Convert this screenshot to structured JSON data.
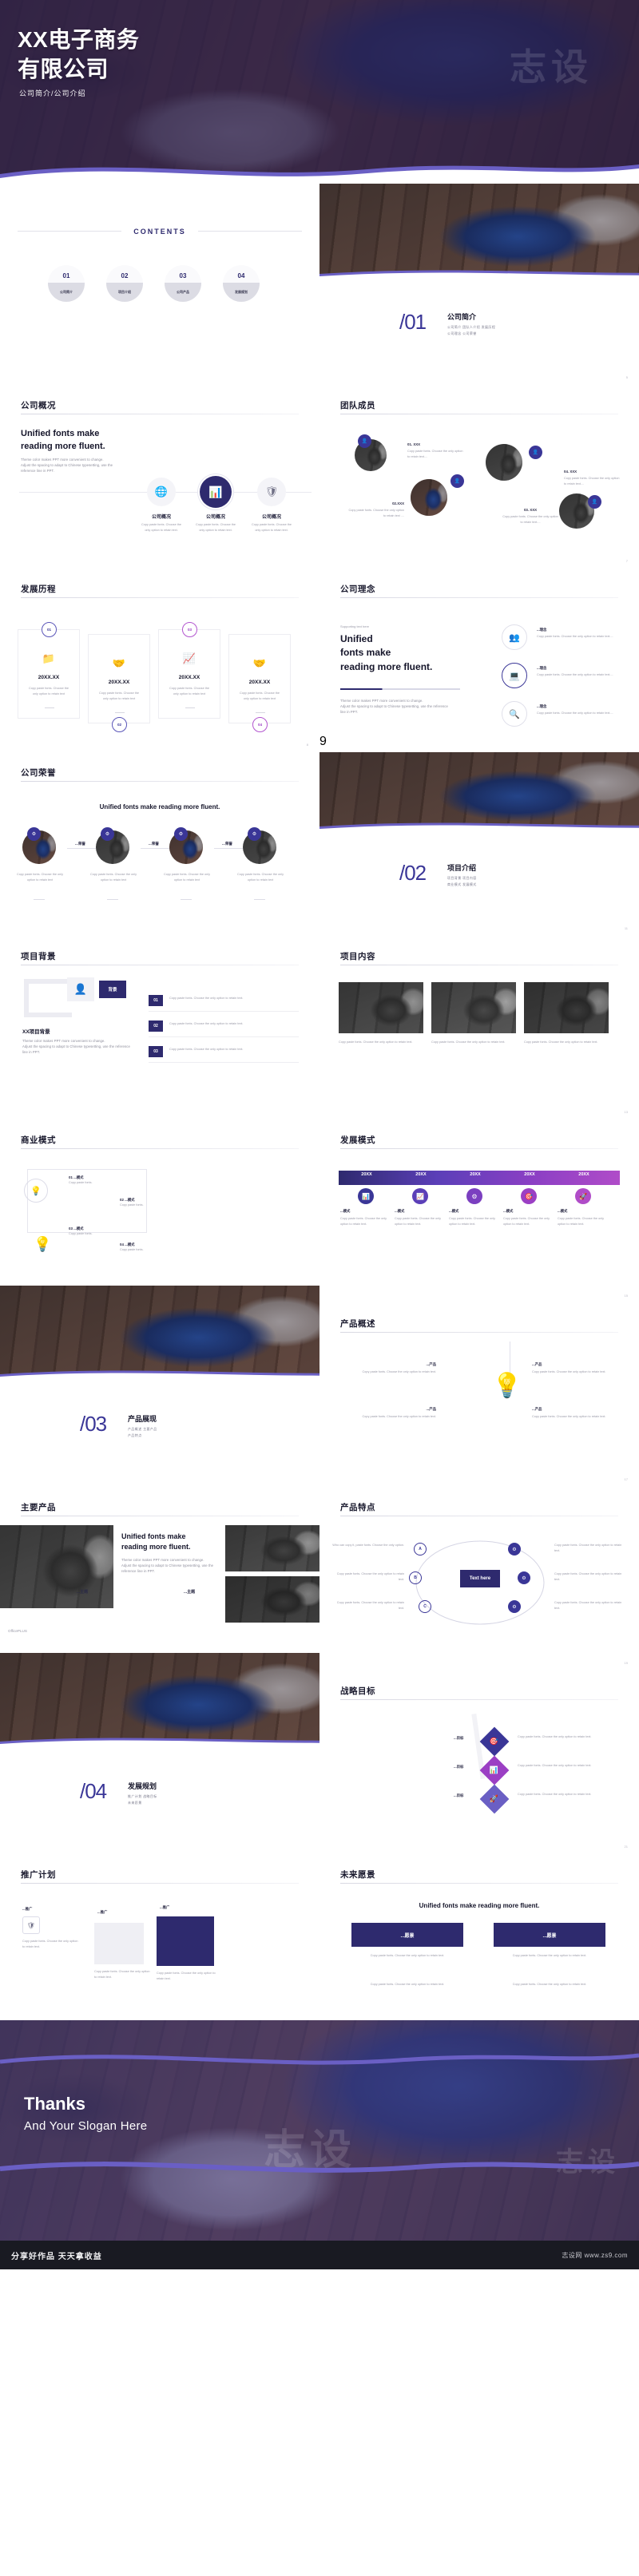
{
  "cover": {
    "title_line1": "XX电子商务",
    "title_line2": "有限公司",
    "subtitle": "公司简介/公司介绍",
    "watermark": "志设"
  },
  "contents": {
    "heading": "CONTENTS",
    "items": [
      {
        "num": "01",
        "label": "公司简介"
      },
      {
        "num": "02",
        "label": "项目介绍"
      },
      {
        "num": "03",
        "label": "公司产品"
      },
      {
        "num": "04",
        "label": "发展规划"
      }
    ]
  },
  "sections": [
    {
      "num": "/01",
      "name": "公司简介",
      "items_l1": "公司简介  团队人介绍  发展历程",
      "items_l2": "公司理念  公司荣誉"
    },
    {
      "num": "/02",
      "name": "项目介绍",
      "items_l1": "项目背景  项目内容",
      "items_l2": "商业模式  发展模式"
    },
    {
      "num": "/03",
      "name": "产品展现",
      "items_l1": "产品概述  主要产品",
      "items_l2": "产品特点"
    },
    {
      "num": "/04",
      "name": "发展规划",
      "items_l1": "推广计划  战略目标",
      "items_l2": "未来愿景"
    }
  ],
  "common": {
    "body_en_1": "Theme color makes PPT more convenient to change.",
    "body_en_2": "Adjust the spacing to adapt to Chinese typesetting, use the",
    "body_en_3": "reference line in PPT.",
    "copy_paste_1": "Copy paste fonts. Choose the",
    "copy_paste_2": "only option to retain text.",
    "copy_paste_long": "Copy paste fonts. Choose the only option to retain text....",
    "heading_2line_a": "Unified fonts make",
    "heading_2line_b": "reading more fluent.",
    "heading_1line": "Unified fonts make reading more fluent.",
    "supporting": "Supporting text here",
    "dash": "——"
  },
  "slide_company_overview": {
    "title": "公司概况",
    "heading_a": "Unified fonts make",
    "heading_b": "reading more fluent.",
    "icons": [
      "globe-icon",
      "chart-bar-icon",
      "shield-icon"
    ],
    "cards": [
      {
        "label": "公司概况",
        "text": "Copy paste fonts. Choose the only option to retain text."
      },
      {
        "label": "公司概况",
        "text": "Copy paste fonts. Choose the only option to retain text."
      },
      {
        "label": "公司概况",
        "text": "Copy paste fonts. Choose the only option to retain text."
      }
    ]
  },
  "slide_team": {
    "title": "团队成员",
    "members": [
      {
        "name": "01. XXX",
        "text": "Copy paste fonts. Choose the only option to retain text...."
      },
      {
        "name": "02.XXX",
        "text": "Copy paste fonts. Choose the only option to retain text ...."
      },
      {
        "name": "03. XXX",
        "text": "Copy paste fonts. Choose the only option to retain text...."
      },
      {
        "name": "04. XXX",
        "text": "Copy paste fonts. Choose the only option to retain text...."
      }
    ]
  },
  "slide_history": {
    "title": "发展历程",
    "steps": [
      {
        "num": "01",
        "date": "20XX.XX",
        "icon": "folder-icon",
        "text_a": "Copy paste fonts. Choose the",
        "text_b": "only option to retain text"
      },
      {
        "num": "02",
        "date": "20XX.XX",
        "icon": "handshake-person-icon",
        "text_a": "Copy paste fonts. Choose the",
        "text_b": "only option to retain text"
      },
      {
        "num": "03",
        "date": "20XX.XX",
        "icon": "growth-chart-icon",
        "text_a": "Copy paste fonts. Choose the",
        "text_b": "only option to retain text"
      },
      {
        "num": "04",
        "date": "20XX.XX",
        "icon": "handshake-icon",
        "text_a": "Copy paste fonts. Choose the",
        "text_b": "only option to retain text"
      }
    ]
  },
  "slide_philosophy": {
    "title": "公司理念",
    "supporting": "Supporting text here",
    "heading_a": "Unified",
    "heading_b": "fonts make",
    "heading_c": "reading more fluent.",
    "body_a": "Theme color makes PPT more convenient to change.",
    "body_b": "Adjust the spacing to adapt to Chinese typesetting, use the reference",
    "body_c": "line in PPT.",
    "items": [
      {
        "label": "...理念",
        "text": "Copy paste fonts. Choose the only option to retain text....",
        "icon": "people-icon"
      },
      {
        "label": "...理念",
        "text": "Copy paste fonts. Choose the only option to retain text....",
        "icon": "desk-icon"
      },
      {
        "label": "...理念",
        "text": "Copy paste fonts. Choose the only option to retain text....",
        "icon": "search-icon"
      }
    ]
  },
  "slide_honors": {
    "title": "公司荣誉",
    "heading": "Unified fonts make reading more fluent.",
    "connector_label": "...荣誉",
    "cards": [
      {
        "text": "Copy paste fonts. Choose the only option to retain text"
      },
      {
        "text": "Copy paste fonts. Choose the only option to retain text"
      },
      {
        "text": "Copy paste fonts. Choose the only option to retain text"
      },
      {
        "text": "Copy paste fonts. Choose the only option to retain text"
      }
    ]
  },
  "slide_bg": {
    "title": "项目背景",
    "badge": "背景",
    "subtitle": "XX项目背景",
    "body_a": "Theme color makes PPT more convenient to change.",
    "body_b": "Adjust the spacing to adapt to Chinese typesetting, use the reference line in PPT.",
    "rows": [
      {
        "num": "01",
        "text": "Copy paste fonts. Choose the only option to retain text."
      },
      {
        "num": "02",
        "text": "Copy paste fonts. Choose the only option to retain text."
      },
      {
        "num": "03",
        "text": "Copy paste fonts. Choose the only option to retain text."
      }
    ]
  },
  "slide_content": {
    "title": "项目内容",
    "cards": [
      {
        "text": "Copy paste fonts. Choose the only option to retain text."
      },
      {
        "text": "Copy paste fonts. Choose the only option to retain text."
      },
      {
        "text": "Copy paste fonts. Choose the only option to retain text."
      }
    ]
  },
  "slide_business": {
    "title": "商业模式",
    "nodes": [
      {
        "label": "01 ...模式",
        "text": "Copy paste fonts."
      },
      {
        "label": "02 ...模式",
        "text": "Copy paste fonts."
      },
      {
        "label": "03 ...模式",
        "text": "Copy paste fonts."
      },
      {
        "label": "04 ...模式",
        "text": "Copy paste fonts."
      }
    ],
    "icon": "lightbulb-icon"
  },
  "slide_devmode": {
    "title": "发展模式",
    "columns": [
      {
        "year": "20XX",
        "label": "...模式",
        "text": "Copy paste fonts. Choose the only option to retain text."
      },
      {
        "year": "20XX",
        "label": "...模式",
        "text": "Copy paste fonts. Choose the only option to retain text."
      },
      {
        "year": "20XX",
        "label": "...模式",
        "text": "Copy paste fonts. Choose the only option to retain text."
      },
      {
        "year": "20XX",
        "label": "...模式",
        "text": "Copy paste fonts. Choose the only option to retain text."
      },
      {
        "year": "20XX",
        "label": "...模式",
        "text": "Copy paste fonts. Choose the only option to retain text."
      }
    ]
  },
  "slide_prod_overview": {
    "title": "产品概述",
    "icon": "lightbulb-icon",
    "items": [
      {
        "label": "...产品",
        "text": "Copy paste fonts. Choose the only option to retain text."
      },
      {
        "label": "...产品",
        "text": "Copy paste fonts. Choose the only option to retain text."
      },
      {
        "label": "...产品",
        "text": "Copy paste fonts. Choose the only option to retain text."
      },
      {
        "label": "...产品",
        "text": "Copy paste fonts. Choose the only option to retain text."
      }
    ]
  },
  "slide_main_prod": {
    "title": "主要产品",
    "heading_a": "Unified fonts make",
    "heading_b": "reading more fluent.",
    "body_a": "Theme color makes PPT more convenient to change.",
    "body_b": "Adjust the spacing to adapt to Chinese typesetting, use the",
    "body_c": "reference line in PPT.",
    "tags": [
      "...主题",
      "...主题"
    ],
    "footer": "OfficePLUS"
  },
  "slide_prod_feature": {
    "title": "产品特点",
    "center": "Text here",
    "left_items": [
      {
        "tag": "A",
        "text": "Who can copy it, paste fonts. Choose the only option."
      },
      {
        "tag": "B",
        "text": "Copy paste fonts. Choose the only option to retain text."
      },
      {
        "tag": "C",
        "text": "Copy paste fonts. Choose the only option to retain text."
      }
    ],
    "right_items": [
      {
        "text": "Copy paste fonts. Choose the only option to retain text."
      },
      {
        "text": "Copy paste fonts. Choose the only option to retain text."
      },
      {
        "text": "Copy paste fonts. Choose the only option to retain text."
      }
    ]
  },
  "slide_strategy": {
    "title": "战略目标",
    "pen_icon": "pen-icon",
    "items": [
      {
        "label": "...目标",
        "text": "Copy paste fonts. Choose the only option to retain text."
      },
      {
        "label": "...目标",
        "text": "Copy paste fonts. Choose the only option to retain text."
      },
      {
        "label": "...目标",
        "text": "Copy paste fonts. Choose the only option to retain text."
      }
    ]
  },
  "slide_promo": {
    "title": "推广计划",
    "cards": [
      {
        "label": "...推广",
        "text": "Copy paste fonts. Choose the only option to retain text."
      },
      {
        "label": "...推广",
        "text": "Copy paste fonts. Choose the only option to retain text."
      },
      {
        "label": "...推广",
        "text": "Copy paste fonts. Choose the only option to retain text."
      }
    ]
  },
  "slide_vision": {
    "title": "未来愿景",
    "heading": "Unified fonts make reading more fluent.",
    "cards": [
      {
        "label": "...愿景",
        "text": "Copy paste fonts. Choose the only option to retain text."
      },
      {
        "label": "...愿景",
        "text": "Copy paste fonts. Choose the only option to retain text."
      }
    ],
    "bottom_text_a": "Copy paste fonts. Choose the only option to retain text.",
    "bottom_text_b": "Copy paste fonts. Choose the only option to retain text."
  },
  "thanks": {
    "line1": "Thanks",
    "line2": "And Your Slogan Here",
    "watermark": "志设"
  },
  "footer": {
    "left": "分享好作品 天天拿收益",
    "right": "志设网 www.zs9.com"
  },
  "colors": {
    "accent": "#3a3697",
    "deep": "#2e2a6e",
    "wave": "#6a5fc4",
    "dark": "#191a22",
    "magenta": "#9b3fc4"
  }
}
